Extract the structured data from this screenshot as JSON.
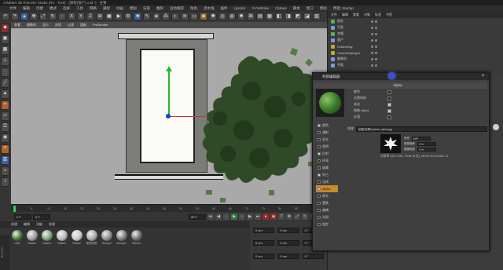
{
  "window": {
    "title": "CINEMA 4D R19.057 Studio (RC - R19) - [课程(窗户).c4d *] - 主要"
  },
  "menubar": {
    "items": [
      "文件",
      "编辑",
      "创建",
      "模式",
      "选择",
      "工具",
      "网格",
      "捕捉",
      "动画",
      "模拟",
      "渲染",
      "雕刻",
      "运动跟踪",
      "角色",
      "流水线",
      "插件",
      "Lipstick",
      "X-Particles",
      "Octane",
      "脚本",
      "窗口",
      "帮助",
      "界面: Startup"
    ]
  },
  "toolbar": {
    "icons": [
      "undo-icon",
      "redo-icon",
      "select-icon",
      "move-icon",
      "scale-icon",
      "rotate-icon",
      "live-select-icon",
      "x-axis-icon",
      "y-axis-icon",
      "z-axis-icon",
      "coord-icon",
      "render-view-icon",
      "render-icon",
      "render-settings-icon",
      "cube-icon",
      "pen-icon",
      "subdivide-icon",
      "array-icon",
      "boole-icon",
      "deformer-icon",
      "floor-icon",
      "camera-icon",
      "light-icon"
    ]
  },
  "viewport": {
    "menu": [
      "查看",
      "摄像机",
      "显示",
      "选项",
      "过滤",
      "面板",
      "ProRender"
    ]
  },
  "timeline": {
    "ticks": [
      "0",
      "5",
      "10",
      "15",
      "20",
      "25",
      "30",
      "35",
      "40",
      "45",
      "50",
      "55",
      "60",
      "65",
      "70",
      "75",
      "80",
      "85",
      "90"
    ],
    "current_frame": "0 F",
    "start_field": "0 F",
    "end_field": "90 F",
    "end_field2": "90 F"
  },
  "materials": {
    "menu": [
      "创建",
      "编辑",
      "功能",
      "纹理"
    ],
    "items": [
      {
        "name": "Leaf",
        "color": "#3c7a2c"
      },
      {
        "name": "Octane",
        "color": "#9b9b9b"
      },
      {
        "name": "Octane",
        "color": "#7aa07a"
      },
      {
        "name": "Octane",
        "color": "#b8b8b8"
      },
      {
        "name": "Octane",
        "color": "#c8c8c8"
      },
      {
        "name": "常领材质",
        "color": "#a8a8a8"
      },
      {
        "name": "Mossy2",
        "color": "#8a8a8a"
      },
      {
        "name": "Mossy3",
        "color": "#7a7a7a"
      },
      {
        "name": "Wood3",
        "color": "#6b6b6b"
      }
    ]
  },
  "coords": {
    "fields": [
      "0 cm",
      "0 cm",
      "0 °",
      "0 cm",
      "0 cm",
      "0 °",
      "0 cm",
      "0 cm",
      "0 °"
    ]
  },
  "object_manager": {
    "menu": [
      "文件",
      "编辑",
      "查看",
      "对象",
      "标签",
      "书签"
    ],
    "rows": [
      {
        "name": "矩形",
        "icon": "g",
        "selected": false
      },
      {
        "name": "平面",
        "icon": "b",
        "selected": false
      },
      {
        "name": "克隆",
        "icon": "g",
        "selected": false
      },
      {
        "name": "窗户",
        "icon": "b",
        "selected": false
      },
      {
        "name": "OctaneSky",
        "icon": "y",
        "selected": false
      },
      {
        "name": "OctaneDayLight",
        "icon": "y",
        "selected": false
      },
      {
        "name": "摄像机",
        "icon": "b",
        "selected": false
      },
      {
        "name": "平面",
        "icon": "b",
        "selected": false
      }
    ]
  },
  "material_dialog": {
    "title": "材质编辑器",
    "section": "Alpha",
    "props": [
      {
        "label": "颜色",
        "checked": false
      },
      {
        "label": "交替材质",
        "checked": false
      },
      {
        "label": "软化",
        "checked": true
      },
      {
        "label": "图像 Alpha",
        "checked": true
      },
      {
        "label": "反相",
        "checked": false
      }
    ],
    "channels": [
      {
        "label": "颜色",
        "on": true,
        "selected": false
      },
      {
        "label": "漫射",
        "on": false,
        "selected": false
      },
      {
        "label": "发光",
        "on": false,
        "selected": false
      },
      {
        "label": "透明",
        "on": false,
        "selected": false
      },
      {
        "label": "反射",
        "on": true,
        "selected": false
      },
      {
        "label": "环境",
        "on": false,
        "selected": false
      },
      {
        "label": "烟雾",
        "on": false,
        "selected": false
      },
      {
        "label": "凹凸",
        "on": true,
        "selected": false
      },
      {
        "label": "法线",
        "on": false,
        "selected": false
      },
      {
        "label": "Alpha",
        "on": true,
        "selected": true
      },
      {
        "label": "辉光",
        "on": false,
        "selected": false
      },
      {
        "label": "置换",
        "on": false,
        "selected": false
      },
      {
        "label": "编辑",
        "on": false,
        "selected": false
      },
      {
        "label": "光照",
        "on": false,
        "selected": false
      },
      {
        "label": "指定",
        "on": false,
        "selected": false
      }
    ],
    "texture_label": "纹理",
    "texture_path": "贴图\\纹理\\ivy\\leaf_alpha.jpg",
    "sub_fields": [
      {
        "label": "采样",
        "value": "MIP"
      },
      {
        "label": "模糊偏移",
        "value": "0 %"
      },
      {
        "label": "模糊程度",
        "value": "0 %"
      }
    ],
    "resolution": "分辨率 483 x 561, RGB (8 位), sRGB IEC61966-2.1"
  }
}
